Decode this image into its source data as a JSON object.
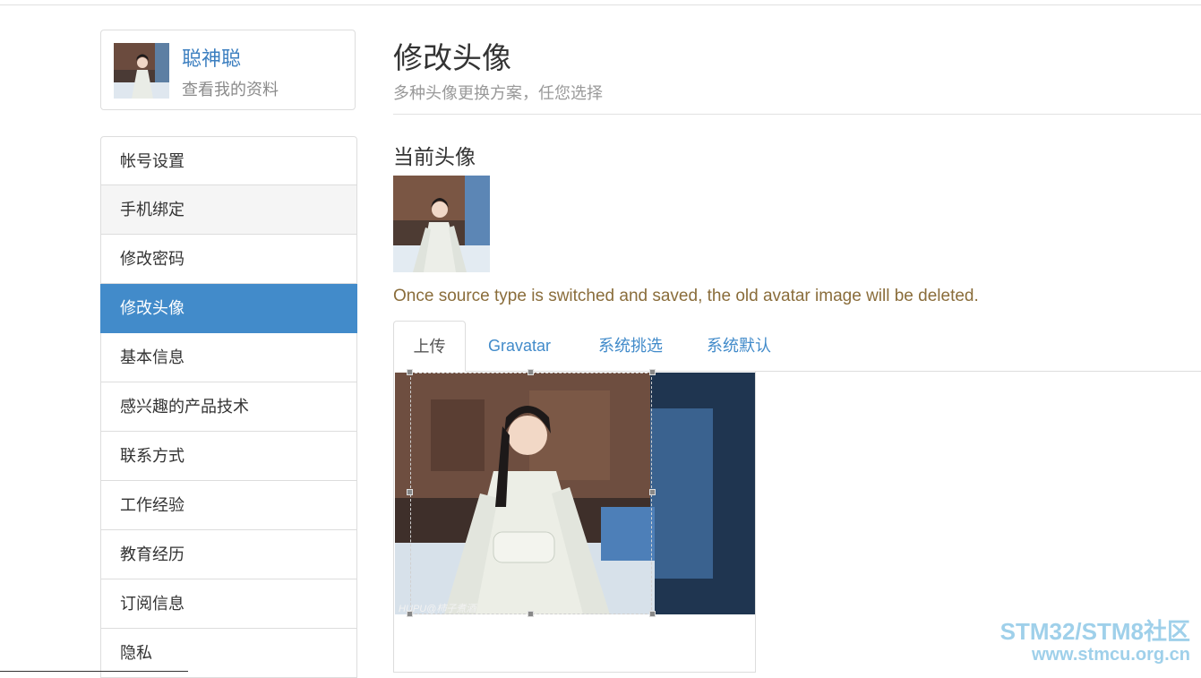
{
  "profile": {
    "name": "聪神聪",
    "view_profile": "查看我的资料"
  },
  "menu": {
    "items": [
      {
        "label": "帐号设置"
      },
      {
        "label": "手机绑定"
      },
      {
        "label": "修改密码"
      },
      {
        "label": "修改头像"
      },
      {
        "label": "基本信息"
      },
      {
        "label": "感兴趣的产品技术"
      },
      {
        "label": "联系方式"
      },
      {
        "label": "工作经验"
      },
      {
        "label": "教育经历"
      },
      {
        "label": "订阅信息"
      },
      {
        "label": "隐私"
      }
    ],
    "active_index": 3
  },
  "header": {
    "title": "修改头像",
    "subtitle": "多种头像更换方案，任您选择"
  },
  "current": {
    "title": "当前头像"
  },
  "warning": "Once source type is switched and saved, the old avatar image will be deleted.",
  "tabs": [
    {
      "label": "上传"
    },
    {
      "label": "Gravatar"
    },
    {
      "label": "系统挑选"
    },
    {
      "label": "系统默认"
    }
  ],
  "crop": {
    "credit": "HUPU@柿子煮酒"
  },
  "watermark": {
    "line1": "STM32/STM8社区",
    "line2": "www.stmcu.org.cn"
  },
  "colors": {
    "accent": "#428bca",
    "link": "#3c7fc0",
    "warning": "#8a6d3b",
    "watermark": "#9fd0ea"
  }
}
